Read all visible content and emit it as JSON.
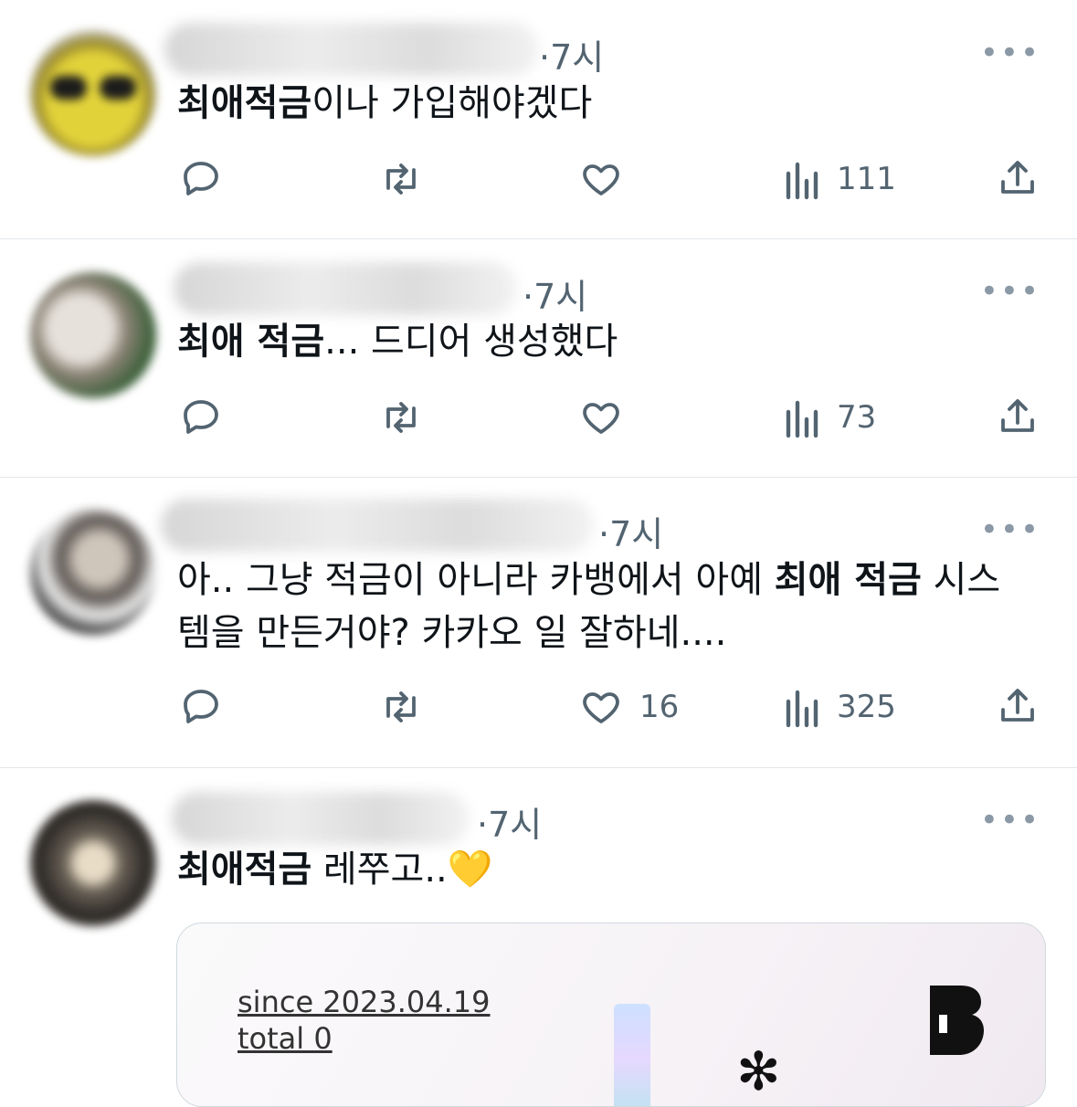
{
  "tweets": [
    {
      "time": "·7시",
      "text_bold": "최애적금",
      "text_rest": "이나 가입해야겠다",
      "reply_count": "",
      "retweet_count": "",
      "like_count": "",
      "views": "111"
    },
    {
      "time": "·7시",
      "text_bold": "최애 적금",
      "text_rest": "... 드디어 생성했다",
      "reply_count": "",
      "retweet_count": "",
      "like_count": "",
      "views": "73"
    },
    {
      "time": "·7시",
      "text_pre": "아.. 그냥 적금이 아니라 카뱅에서 아예 ",
      "text_bold": "최애 적금",
      "text_post": " 시스",
      "text_line2": "템을 만든거야? 카카오 일 잘하네....",
      "like_count": "16",
      "views": "325"
    },
    {
      "time": "·7시",
      "text_bold": "최애적금",
      "text_rest": " 레쭈고..",
      "emoji": "💛",
      "card": {
        "since": "since 2023.04.19",
        "total": "total 0"
      }
    }
  ],
  "icons": {
    "reply": "reply-icon",
    "retweet": "retweet-icon",
    "like": "heart-icon",
    "views": "views-icon",
    "share": "share-icon",
    "more": "more-icon"
  },
  "more_label": "•••",
  "colors": {
    "muted": "#536471",
    "divider": "#e1e6ea"
  }
}
